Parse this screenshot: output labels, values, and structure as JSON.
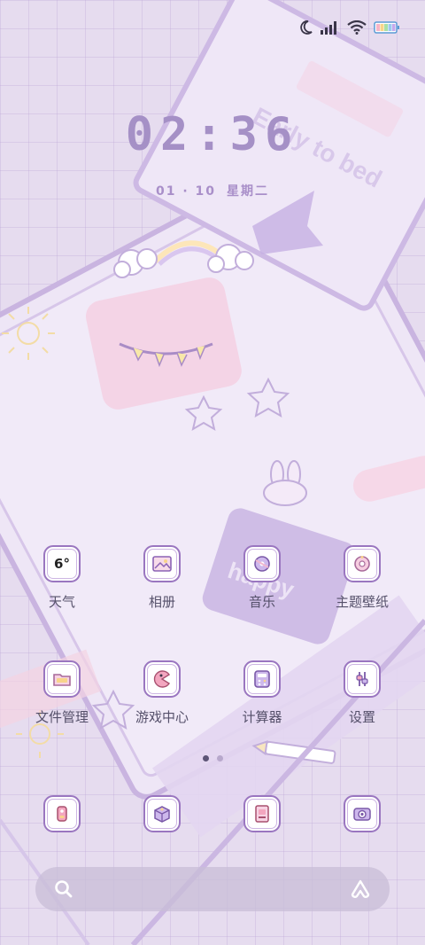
{
  "status_bar": {
    "icons": [
      "moon-icon",
      "signal-icon",
      "wifi-icon",
      "battery-icon"
    ]
  },
  "wallpaper": {
    "caption_1": "Early to bed",
    "caption_2": "happy"
  },
  "lock_clock": {
    "time": "02:36",
    "date": "01 · 10",
    "weekday": "星期二"
  },
  "home": {
    "rows": [
      [
        {
          "label": "天气",
          "icon": "weather-icon",
          "badge": "6°"
        },
        {
          "label": "相册",
          "icon": "gallery-icon"
        },
        {
          "label": "音乐",
          "icon": "music-icon"
        },
        {
          "label": "主题壁纸",
          "icon": "theme-icon"
        }
      ],
      [
        {
          "label": "文件管理",
          "icon": "files-icon"
        },
        {
          "label": "游戏中心",
          "icon": "game-icon"
        },
        {
          "label": "计算器",
          "icon": "calculator-icon"
        },
        {
          "label": "设置",
          "icon": "settings-icon"
        }
      ]
    ],
    "page_count": 2,
    "active_page": 1,
    "dock": [
      {
        "icon": "phone-icon"
      },
      {
        "icon": "messages-icon"
      },
      {
        "icon": "browser-icon"
      },
      {
        "icon": "camera-icon"
      }
    ]
  },
  "search": {
    "icons": [
      "search-icon",
      "assistant-icon"
    ]
  },
  "colors": {
    "accent": "#9a76c0",
    "clock": "#a590c6",
    "background": "#e6dcef"
  }
}
